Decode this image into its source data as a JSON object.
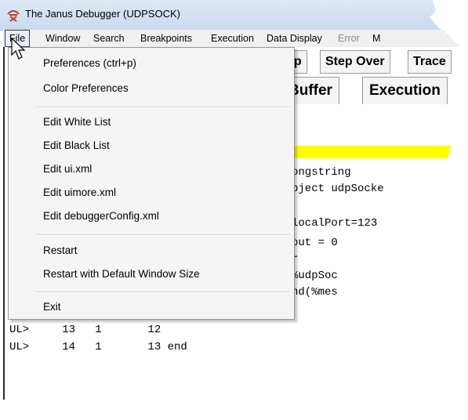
{
  "window": {
    "title": "The Janus Debugger (UDPSOCK)",
    "icon": "janus-app-icon"
  },
  "menubar": {
    "items": [
      {
        "label": "File"
      },
      {
        "label": "Window"
      },
      {
        "label": "Search"
      },
      {
        "label": "Breakpoints"
      },
      {
        "label": "Execution"
      },
      {
        "label": "Data Display"
      },
      {
        "label": "Error"
      },
      {
        "label": "M"
      }
    ]
  },
  "toolbar": {
    "step_label": "ep",
    "step_over_label": "Step Over",
    "trace_label": "Trace"
  },
  "tabs": {
    "buffer_label": "Buffer",
    "execution_label": "Execution"
  },
  "code": {
    "lines": [
      "ongstring",
      "bject udpSocke",
      "",
      "localPort=123",
      "out = 0",
      "r",
      "%udpSoc",
      "nd(%mes"
    ]
  },
  "console": {
    "lines": [
      "UL>     13   1       12",
      "UL>     14   1       13 end"
    ]
  },
  "file_menu": {
    "items": [
      "Preferences (ctrl+p)",
      "Color Preferences",
      "Edit White List",
      "Edit Black List",
      "Edit ui.xml",
      "Edit uimore.xml",
      "Edit debuggerConfig.xml",
      "Restart",
      "Restart with Default Window Size",
      "Exit"
    ]
  },
  "colors": {
    "highlight": "#ffff00",
    "titlebar": "#c9dbee"
  }
}
